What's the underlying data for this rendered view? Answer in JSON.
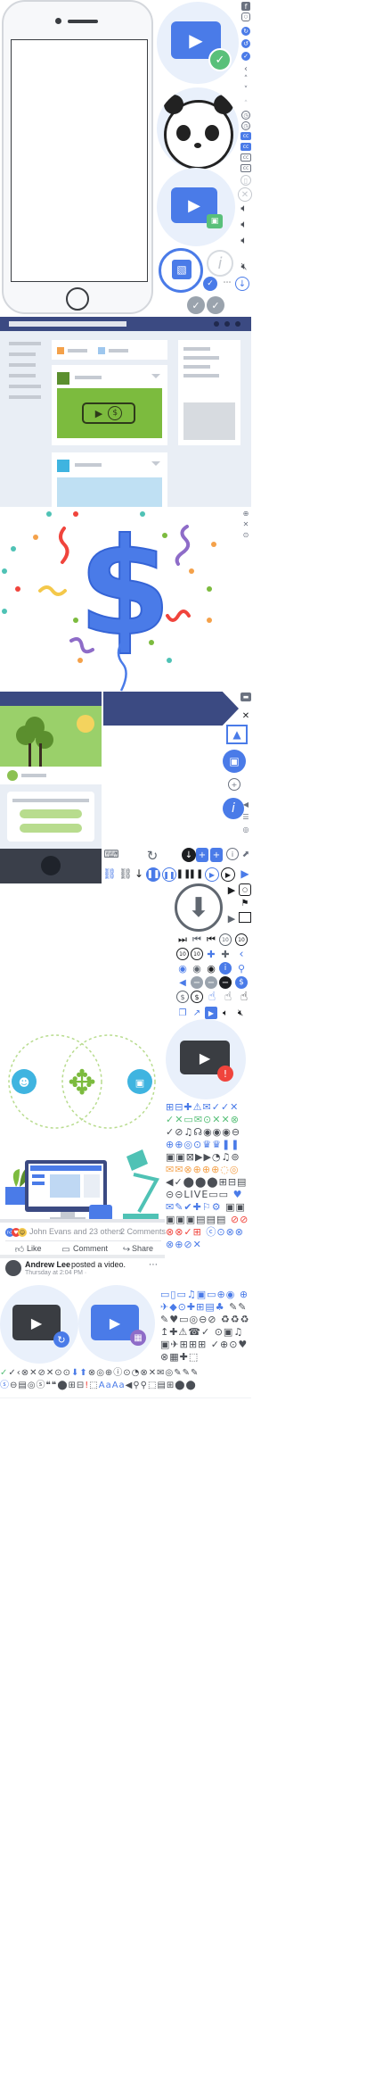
{
  "colors": {
    "brand_blue": "#4a7be8",
    "dark_navy": "#3b4a82",
    "light_bg": "#e9eef5",
    "green_video": "#7cbb3e",
    "success_green": "#59c07a",
    "warning_red": "#f0443c",
    "teal": "#4fc2b5"
  },
  "video_post": {
    "reactions_text": "John Evans and 23 others",
    "comments_text": "2 Comments",
    "actions": [
      "Like",
      "Comment",
      "Share"
    ],
    "author": "Andrew Lee",
    "post_action": " posted a video.",
    "timestamp": "Thursday at 2:04 PM · "
  },
  "icons": {
    "sprite_column": [
      "facebook-icon",
      "instagram-icon",
      "sync-icon",
      "refresh-icon",
      "check-circle-icon",
      "chevron-left-icon",
      "chevron-up-icon",
      "chevron-down-icon",
      "clock-icon",
      "closed-caption-icon",
      "close-circle-icon",
      "volume-icon",
      "info-icon",
      "download-icon"
    ],
    "play_glyph": "▶",
    "check_glyph": "✓",
    "dollar_glyph": "$",
    "download_glyph": "↓"
  },
  "sprite_grid_symbols": "✓✕↻↺▶⏸⏭⏮⬇⬆★☆♥♡⚑⚐☰⋯⊕⊖⊗⊘⊙◀◁▷▸▹◂▴▾◆◇○●□■△▲▽▼",
  "bottom_strip_symbols": "✓✓‹✕⊘≡◉⦿Aa Aa◀▶⚙✎✚☺⬇⬆"
}
